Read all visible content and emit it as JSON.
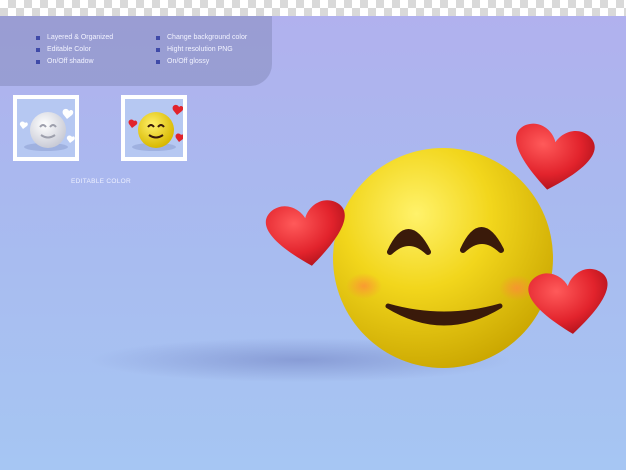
{
  "features": {
    "col1": [
      "Layered & Organized",
      "Editable Color",
      "On/Off shadow"
    ],
    "col2": [
      "Change background color",
      "Hight resolution PNG",
      "On/Off glossy"
    ]
  },
  "thumbnails": {
    "caption": "EDITABLE COLOR",
    "variants": [
      "white-emoji-icon",
      "yellow-emoji-icon"
    ]
  },
  "colors": {
    "emoji_yellow": "#f2d61c",
    "heart_red": "#e2232c",
    "mouth_dark": "#3a1a0a",
    "background_top": "#b1b1ee",
    "background_bottom": "#a6c6f3"
  },
  "main_icon": "smiling-face-with-hearts-emoji"
}
